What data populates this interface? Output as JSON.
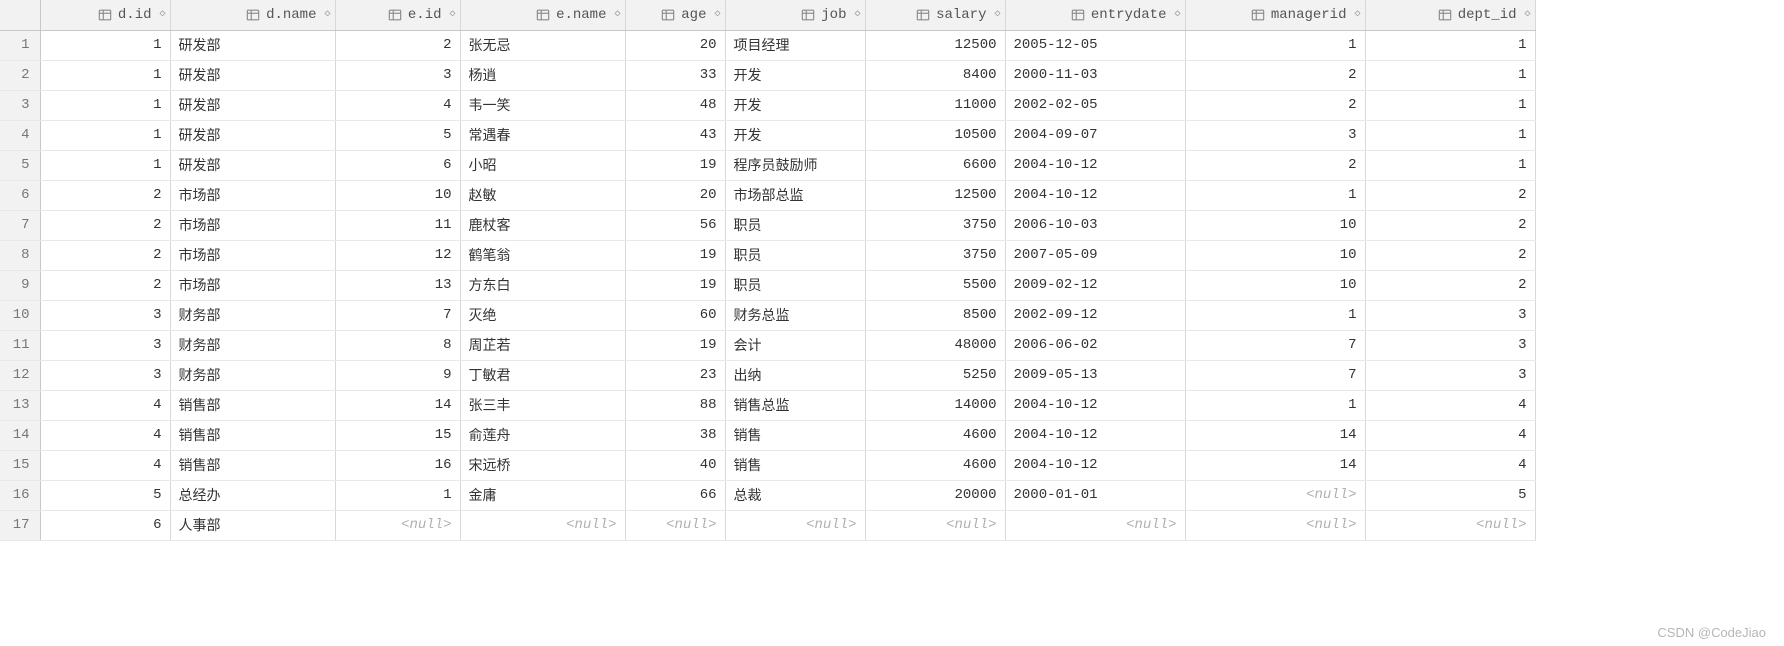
{
  "watermark": "CSDN @CodeJiao",
  "null_text": "<null>",
  "columns": [
    {
      "key": "d_id",
      "label": "d.id",
      "align": "right",
      "wclass": "w-did"
    },
    {
      "key": "d_name",
      "label": "d.name",
      "align": "left",
      "wclass": "w-dname"
    },
    {
      "key": "e_id",
      "label": "e.id",
      "align": "right",
      "wclass": "w-eid"
    },
    {
      "key": "e_name",
      "label": "e.name",
      "align": "left",
      "wclass": "w-ename"
    },
    {
      "key": "age",
      "label": "age",
      "align": "right",
      "wclass": "w-age"
    },
    {
      "key": "job",
      "label": "job",
      "align": "left",
      "wclass": "w-job"
    },
    {
      "key": "salary",
      "label": "salary",
      "align": "right",
      "wclass": "w-salary"
    },
    {
      "key": "entrydate",
      "label": "entrydate",
      "align": "left",
      "wclass": "w-entry"
    },
    {
      "key": "managerid",
      "label": "managerid",
      "align": "right",
      "wclass": "w-mgr"
    },
    {
      "key": "dept_id",
      "label": "dept_id",
      "align": "right",
      "wclass": "w-dept"
    }
  ],
  "rows": [
    {
      "n": 1,
      "d_id": 1,
      "d_name": "研发部",
      "e_id": 2,
      "e_name": "张无忌",
      "age": 20,
      "job": "项目经理",
      "salary": 12500,
      "entrydate": "2005-12-05",
      "managerid": 1,
      "dept_id": 1
    },
    {
      "n": 2,
      "d_id": 1,
      "d_name": "研发部",
      "e_id": 3,
      "e_name": "杨逍",
      "age": 33,
      "job": "开发",
      "salary": 8400,
      "entrydate": "2000-11-03",
      "managerid": 2,
      "dept_id": 1
    },
    {
      "n": 3,
      "d_id": 1,
      "d_name": "研发部",
      "e_id": 4,
      "e_name": "韦一笑",
      "age": 48,
      "job": "开发",
      "salary": 11000,
      "entrydate": "2002-02-05",
      "managerid": 2,
      "dept_id": 1
    },
    {
      "n": 4,
      "d_id": 1,
      "d_name": "研发部",
      "e_id": 5,
      "e_name": "常遇春",
      "age": 43,
      "job": "开发",
      "salary": 10500,
      "entrydate": "2004-09-07",
      "managerid": 3,
      "dept_id": 1
    },
    {
      "n": 5,
      "d_id": 1,
      "d_name": "研发部",
      "e_id": 6,
      "e_name": "小昭",
      "age": 19,
      "job": "程序员鼓励师",
      "salary": 6600,
      "entrydate": "2004-10-12",
      "managerid": 2,
      "dept_id": 1
    },
    {
      "n": 6,
      "d_id": 2,
      "d_name": "市场部",
      "e_id": 10,
      "e_name": "赵敏",
      "age": 20,
      "job": "市场部总监",
      "salary": 12500,
      "entrydate": "2004-10-12",
      "managerid": 1,
      "dept_id": 2
    },
    {
      "n": 7,
      "d_id": 2,
      "d_name": "市场部",
      "e_id": 11,
      "e_name": "鹿杖客",
      "age": 56,
      "job": "职员",
      "salary": 3750,
      "entrydate": "2006-10-03",
      "managerid": 10,
      "dept_id": 2
    },
    {
      "n": 8,
      "d_id": 2,
      "d_name": "市场部",
      "e_id": 12,
      "e_name": "鹤笔翁",
      "age": 19,
      "job": "职员",
      "salary": 3750,
      "entrydate": "2007-05-09",
      "managerid": 10,
      "dept_id": 2
    },
    {
      "n": 9,
      "d_id": 2,
      "d_name": "市场部",
      "e_id": 13,
      "e_name": "方东白",
      "age": 19,
      "job": "职员",
      "salary": 5500,
      "entrydate": "2009-02-12",
      "managerid": 10,
      "dept_id": 2
    },
    {
      "n": 10,
      "d_id": 3,
      "d_name": "财务部",
      "e_id": 7,
      "e_name": "灭绝",
      "age": 60,
      "job": "财务总监",
      "salary": 8500,
      "entrydate": "2002-09-12",
      "managerid": 1,
      "dept_id": 3
    },
    {
      "n": 11,
      "d_id": 3,
      "d_name": "财务部",
      "e_id": 8,
      "e_name": "周芷若",
      "age": 19,
      "job": "会计",
      "salary": 48000,
      "entrydate": "2006-06-02",
      "managerid": 7,
      "dept_id": 3
    },
    {
      "n": 12,
      "d_id": 3,
      "d_name": "财务部",
      "e_id": 9,
      "e_name": "丁敏君",
      "age": 23,
      "job": "出纳",
      "salary": 5250,
      "entrydate": "2009-05-13",
      "managerid": 7,
      "dept_id": 3
    },
    {
      "n": 13,
      "d_id": 4,
      "d_name": "销售部",
      "e_id": 14,
      "e_name": "张三丰",
      "age": 88,
      "job": "销售总监",
      "salary": 14000,
      "entrydate": "2004-10-12",
      "managerid": 1,
      "dept_id": 4
    },
    {
      "n": 14,
      "d_id": 4,
      "d_name": "销售部",
      "e_id": 15,
      "e_name": "俞莲舟",
      "age": 38,
      "job": "销售",
      "salary": 4600,
      "entrydate": "2004-10-12",
      "managerid": 14,
      "dept_id": 4
    },
    {
      "n": 15,
      "d_id": 4,
      "d_name": "销售部",
      "e_id": 16,
      "e_name": "宋远桥",
      "age": 40,
      "job": "销售",
      "salary": 4600,
      "entrydate": "2004-10-12",
      "managerid": 14,
      "dept_id": 4
    },
    {
      "n": 16,
      "d_id": 5,
      "d_name": "总经办",
      "e_id": 1,
      "e_name": "金庸",
      "age": 66,
      "job": "总裁",
      "salary": 20000,
      "entrydate": "2000-01-01",
      "managerid": null,
      "dept_id": 5
    },
    {
      "n": 17,
      "d_id": 6,
      "d_name": "人事部",
      "e_id": null,
      "e_name": null,
      "age": null,
      "job": null,
      "salary": null,
      "entrydate": null,
      "managerid": null,
      "dept_id": null
    }
  ]
}
